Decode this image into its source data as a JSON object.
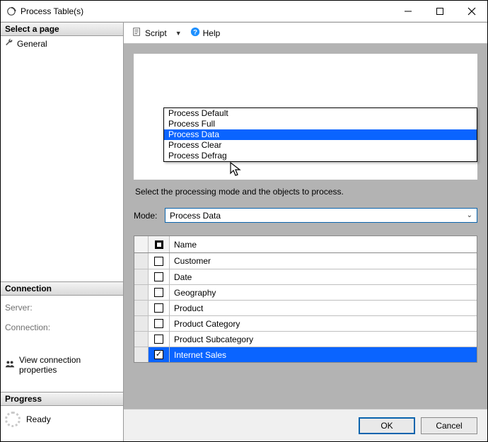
{
  "window": {
    "title": "Process Table(s)"
  },
  "left": {
    "select_page_header": "Select a page",
    "general_label": "General",
    "connection_header": "Connection",
    "server_label": "Server:",
    "connection_label": "Connection:",
    "view_conn_props": "View connection properties",
    "progress_header": "Progress",
    "progress_status": "Ready"
  },
  "toolbar": {
    "script_label": "Script",
    "help_label": "Help"
  },
  "main": {
    "instruction": "Select the processing mode and the objects to process.",
    "mode_label": "Mode:",
    "mode_value": "Process Data",
    "mode_options": [
      "Process Default",
      "Process Full",
      "Process Data",
      "Process Clear",
      "Process Defrag"
    ],
    "mode_highlighted_index": 2,
    "grid_header_name": "Name",
    "rows": [
      {
        "name": "Customer",
        "checked": false,
        "selected": false
      },
      {
        "name": "Date",
        "checked": false,
        "selected": false
      },
      {
        "name": "Geography",
        "checked": false,
        "selected": false
      },
      {
        "name": "Product",
        "checked": false,
        "selected": false
      },
      {
        "name": "Product Category",
        "checked": false,
        "selected": false
      },
      {
        "name": "Product Subcategory",
        "checked": false,
        "selected": false
      },
      {
        "name": "Internet Sales",
        "checked": true,
        "selected": true
      }
    ]
  },
  "footer": {
    "ok": "OK",
    "cancel": "Cancel"
  }
}
